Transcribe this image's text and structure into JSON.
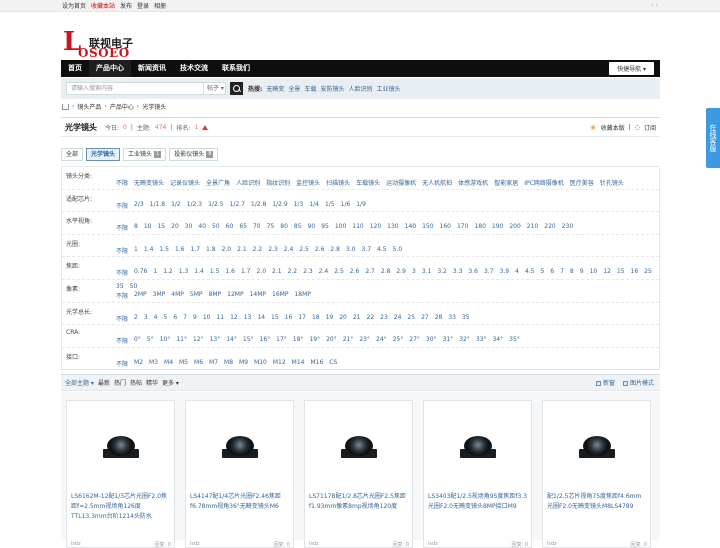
{
  "topbar": {
    "set_home": "设为首页",
    "bookmark": "收藏本站",
    "post": "发布",
    "login": "登录",
    "album": "相册",
    "right": "‹ ›"
  },
  "logo": {
    "big_letter": "L",
    "rest": "OSOEO",
    "cn": "联视电子"
  },
  "nav": {
    "items": [
      "首页",
      "产品中心",
      "新闻资讯",
      "技术交流",
      "联系我们"
    ],
    "quick": "快捷导航"
  },
  "search": {
    "placeholder": "请输入搜索内容",
    "type": "帖子",
    "hot_label": "热搜:",
    "hot": [
      "无畸变",
      "全景",
      "车载",
      "安防镜头",
      "人脸识别",
      "工业镜头"
    ]
  },
  "breadcrumb": [
    "镜头产品",
    "产品中心",
    "光学镜头"
  ],
  "forum": {
    "title": "光学镜头",
    "today_label": "今日:",
    "today": "0",
    "topics_label": "主题:",
    "topics": "474",
    "rank_label": "排名:",
    "rank": "1",
    "fav": "收藏本版",
    "sub": "订阅"
  },
  "tabs": [
    {
      "label": "全部",
      "count": ""
    },
    {
      "label": "光学镜头",
      "count": ""
    },
    {
      "label": "工业镜头",
      "count": "1"
    },
    {
      "label": "投影仪镜头",
      "count": "8"
    }
  ],
  "filters": [
    {
      "label": "镜头分类:",
      "values": [
        "不限",
        "无畸变镜头",
        "记录仪镜头",
        "全景广角",
        "人脸识别",
        "指纹识别",
        "监控镜头",
        "扫描镜头",
        "车载镜头",
        "运动摄像机",
        "无人机航拍",
        "体感游戏机",
        "智能家居",
        "IPC网络摄像机",
        "医疗美容",
        "针孔镜头"
      ]
    },
    {
      "label": "适配芯片:",
      "values": [
        "不限",
        "2/3",
        "1/1.8",
        "1/2",
        "1/2.3",
        "1/2.5",
        "1/2.7",
        "1/2.8",
        "1/2.9",
        "1/3",
        "1/4",
        "1/5",
        "1/6",
        "1/9"
      ]
    },
    {
      "label": "水平视角:",
      "values": [
        "不限",
        "8",
        "10",
        "15",
        "20",
        "30",
        "40",
        "50",
        "60",
        "65",
        "70",
        "75",
        "80",
        "85",
        "90",
        "95",
        "100",
        "110",
        "120",
        "130",
        "140",
        "150",
        "160",
        "170",
        "180",
        "190",
        "200",
        "210",
        "220",
        "230"
      ]
    },
    {
      "label": "光圈:",
      "values": [
        "不限",
        "1",
        "1.4",
        "1.5",
        "1.6",
        "1.7",
        "1.8",
        "2.0",
        "2.1",
        "2.2",
        "2.3",
        "2.4",
        "2.5",
        "2.6",
        "2.8",
        "3.0",
        "3.7",
        "4.5",
        "5.0"
      ]
    },
    {
      "label": "焦距:",
      "values": [
        "不限",
        "0.76",
        "1",
        "1.2",
        "1.3",
        "1.4",
        "1.5",
        "1.6",
        "1.7",
        "2.0",
        "2.1",
        "2.2",
        "2.3",
        "2.4",
        "2.5",
        "2.6",
        "2.7",
        "2.8",
        "2.9",
        "3",
        "3.1",
        "3.2",
        "3.3",
        "3.6",
        "3.7",
        "3.9",
        "4",
        "4.5",
        "5",
        "6",
        "7",
        "8",
        "9",
        "10",
        "12",
        "15",
        "16",
        "25",
        "35",
        "50"
      ]
    },
    {
      "label": "像素:",
      "values": [
        "不限",
        "2MP",
        "3MP",
        "4MP",
        "5MP",
        "8MP",
        "12MP",
        "14MP",
        "16MP",
        "18MP"
      ]
    },
    {
      "label": "光学总长:",
      "values": [
        "不限",
        "2",
        "3",
        "4",
        "5",
        "6",
        "7",
        "9",
        "10",
        "11",
        "12",
        "13",
        "14",
        "15",
        "16",
        "17",
        "18",
        "19",
        "20",
        "21",
        "22",
        "23",
        "24",
        "25",
        "27",
        "28",
        "33",
        "35"
      ]
    },
    {
      "label": "CRA:",
      "values": [
        "不限",
        "0°",
        "5°",
        "10°",
        "11°",
        "12°",
        "13°",
        "14°",
        "15°",
        "16°",
        "17°",
        "18°",
        "19°",
        "20°",
        "21°",
        "23°",
        "24°",
        "25°",
        "27°",
        "30°",
        "31°",
        "32°",
        "33°",
        "34°",
        "35°"
      ]
    },
    {
      "label": "接口:",
      "values": [
        "不限",
        "M2",
        "M3",
        "M4",
        "M5",
        "M6",
        "M7",
        "M8",
        "M9",
        "M10",
        "M12",
        "M14",
        "M16",
        "CS"
      ]
    }
  ],
  "listhead": {
    "all": "全部主题",
    "items": [
      "最新",
      "热门",
      "热帖",
      "精华",
      "更多"
    ],
    "new_window": "新窗",
    "image_mode": "图片模式"
  },
  "cards": [
    {
      "title": "LS6162M-12配1/3芯片光圈F2.0焦距f=2.5mm视场角126度TTL13.3mm台阶1214头防水",
      "author": "lsdz",
      "meta": "回复: 0"
    },
    {
      "title": "LS4147配1/4芯片光圈F2.46焦距f6.78mm视角36°无畸变镜头M6",
      "author": "lsdz",
      "meta": "回复: 0"
    },
    {
      "title": "LS7117B配1/2.8芯片光圈F2.5焦距f1.93mm像素8mp视场角120度",
      "author": "lsdz",
      "meta": "回复: 0"
    },
    {
      "title": "LS3403配1/2.5视场角95度焦距f3.3光圈F2.0无畸变镜头8MP接口M9",
      "author": "lsdz",
      "meta": "回复: 0"
    },
    {
      "title": "配1/2.5芯片视角75度焦距f4.6mm光圈F2.0无畸变镜头M8LS4789",
      "author": "lsdz",
      "meta": "回复: 0"
    }
  ],
  "side": {
    "label": "在线客服"
  }
}
